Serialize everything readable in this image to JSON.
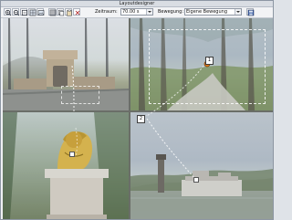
{
  "window": {
    "title": "Layoutdesigner"
  },
  "toolbar": {
    "buttons": [
      {
        "icon": "zoom-in-icon"
      },
      {
        "icon": "zoom-out-icon"
      },
      {
        "icon": "fit-icon"
      },
      {
        "icon": "layout-icon"
      },
      {
        "icon": "image-icon"
      },
      {
        "icon": "grid-icon"
      },
      {
        "icon": "copy-icon"
      },
      {
        "icon": "paste-icon"
      },
      {
        "icon": "delete-icon"
      }
    ],
    "zeitraum": {
      "label": "Zeitraum:",
      "value": "70.00 s"
    },
    "bewegung": {
      "label": "Bewegung:",
      "value": "Eigene Bewegung"
    },
    "save": {
      "icon": "save-icon"
    }
  },
  "canvas": {
    "quadrants": [
      {
        "name": "gatehouse-photo"
      },
      {
        "name": "forest-road-photo"
      },
      {
        "name": "lion-statue-photo"
      },
      {
        "name": "river-castle-photo"
      }
    ],
    "markers": [
      {
        "label": "1"
      },
      {
        "label": "2"
      }
    ],
    "accent": "#ffffff",
    "selection_color": "#ffffff"
  }
}
